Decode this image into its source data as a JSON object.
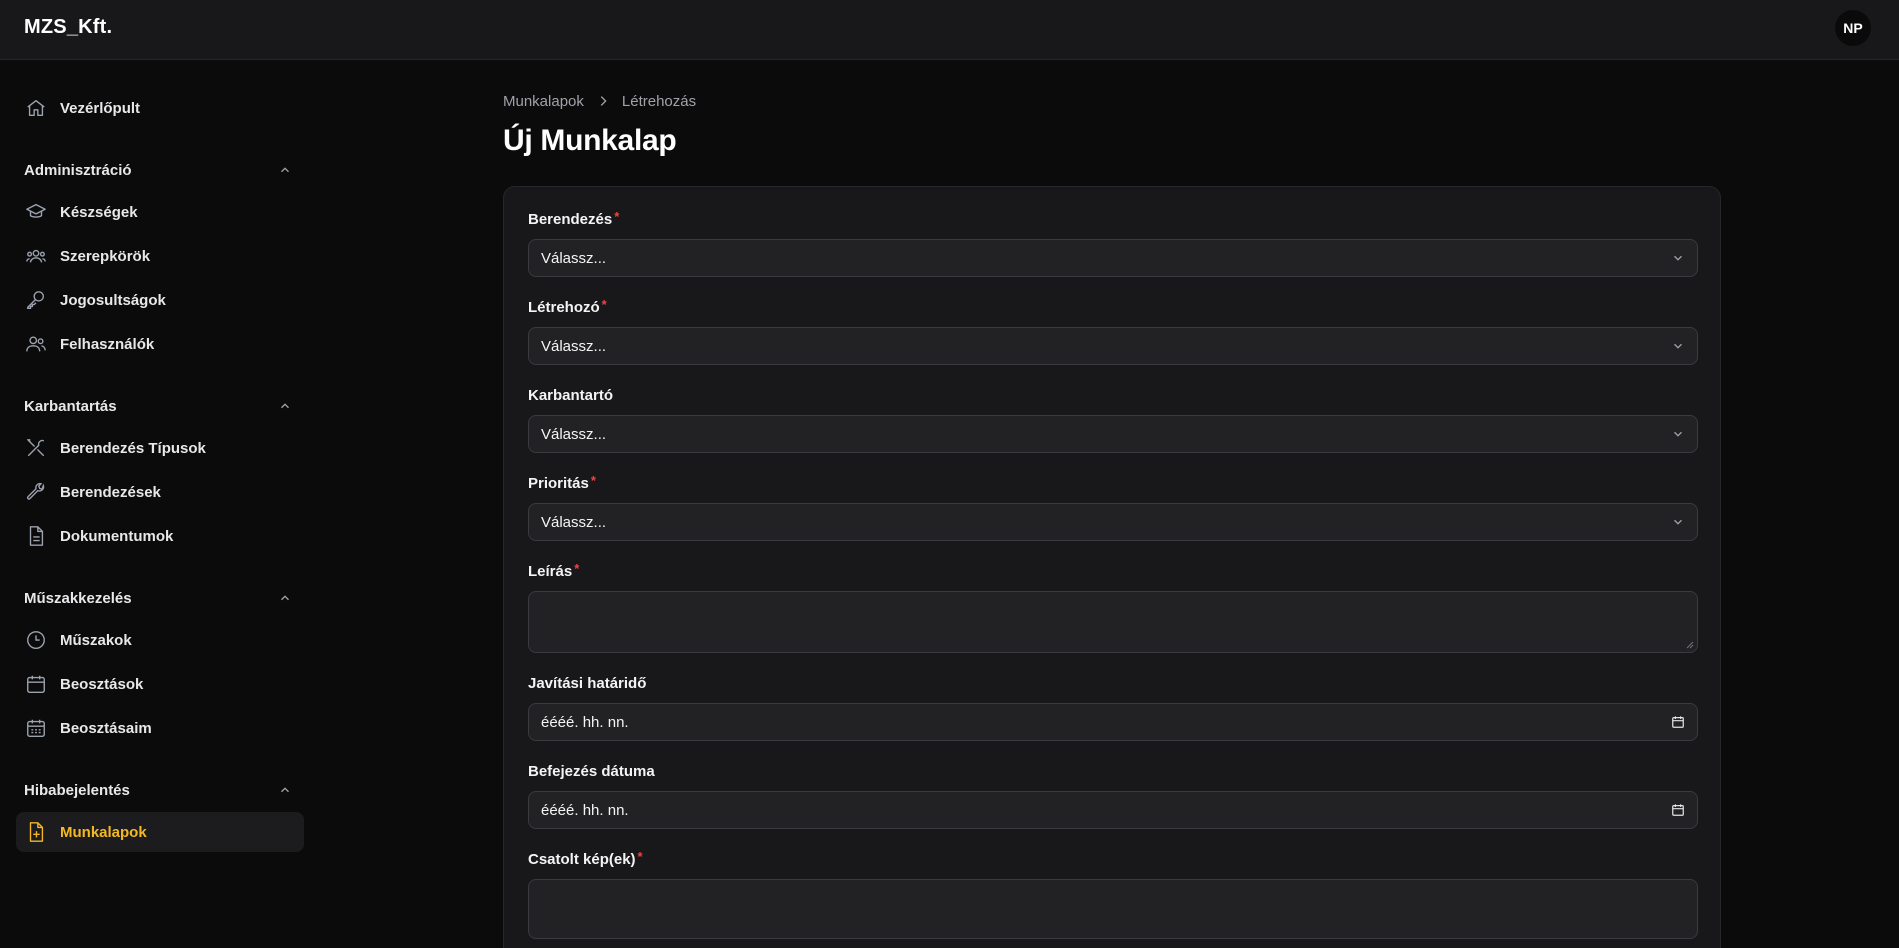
{
  "app": {
    "brand": "MZS_Kft.",
    "avatar_initials": "NP"
  },
  "sidebar": {
    "dashboard": {
      "label": "Vezérlőpult",
      "icon": "home-icon"
    },
    "groups": [
      {
        "title": "Adminisztráció",
        "items": [
          {
            "label": "Készségek",
            "icon": "graduation-cap-icon"
          },
          {
            "label": "Szerepkörök",
            "icon": "users-group-icon"
          },
          {
            "label": "Jogosultságok",
            "icon": "key-icon"
          },
          {
            "label": "Felhasználók",
            "icon": "users-icon"
          }
        ]
      },
      {
        "title": "Karbantartás",
        "items": [
          {
            "label": "Berendezés Típusok",
            "icon": "tools-icon"
          },
          {
            "label": "Berendezések",
            "icon": "wrench-icon"
          },
          {
            "label": "Dokumentumok",
            "icon": "document-icon"
          }
        ]
      },
      {
        "title": "Műszakkezelés",
        "items": [
          {
            "label": "Műszakok",
            "icon": "clock-icon"
          },
          {
            "label": "Beosztások",
            "icon": "calendar-icon"
          },
          {
            "label": "Beosztásaim",
            "icon": "calendar-days-icon"
          }
        ]
      },
      {
        "title": "Hibabejelentés",
        "items": [
          {
            "label": "Munkalapok",
            "icon": "document-plus-icon",
            "active": true
          }
        ]
      }
    ]
  },
  "breadcrumb": {
    "parent": "Munkalapok",
    "current": "Létrehozás"
  },
  "page": {
    "title": "Új Munkalap"
  },
  "form": {
    "required_mark": "*",
    "fields": [
      {
        "label": "Berendezés",
        "required": true,
        "type": "select",
        "value": "Válassz..."
      },
      {
        "label": "Létrehozó",
        "required": true,
        "type": "select",
        "value": "Válassz..."
      },
      {
        "label": "Karbantartó",
        "required": false,
        "type": "select",
        "value": "Válassz..."
      },
      {
        "label": "Prioritás",
        "required": true,
        "type": "select",
        "value": "Válassz..."
      },
      {
        "label": "Leírás",
        "required": true,
        "type": "textarea",
        "value": ""
      },
      {
        "label": "Javítási határidő",
        "required": false,
        "type": "date",
        "value": "éééé. hh. nn."
      },
      {
        "label": "Befejezés dátuma",
        "required": false,
        "type": "date",
        "value": "éééé. hh. nn."
      },
      {
        "label": "Csatolt kép(ek)",
        "required": true,
        "type": "file",
        "value": ""
      }
    ]
  },
  "colors": {
    "background": "#0b0b0c",
    "panel": "#18181b",
    "accent": "#f5b820",
    "required": "#ef4444"
  }
}
